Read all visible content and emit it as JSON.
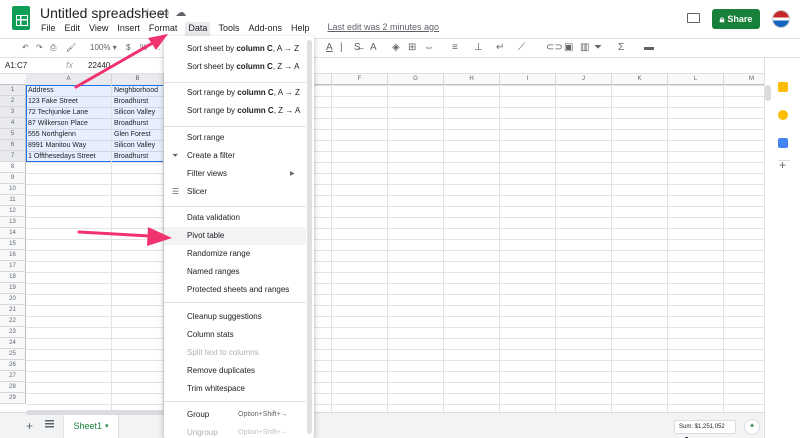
{
  "app": {
    "doc_title": "Untitled spreadsheet",
    "menus": [
      "File",
      "Edit",
      "View",
      "Insert",
      "Format",
      "Data",
      "Tools",
      "Add-ons",
      "Help"
    ],
    "active_menu": "Data",
    "last_edit": "Last edit was 2 minutes ago",
    "share_label": "Share"
  },
  "toolbar": {
    "zoom": "100%",
    "zoom_caret": "▾",
    "partial_percent": "."
  },
  "formula_bar": {
    "name_box": "A1:C7",
    "fx": "fx",
    "value": "22440"
  },
  "columns": [
    "A",
    "B",
    "C",
    "D",
    "E",
    "F",
    "G",
    "H",
    "I",
    "J",
    "K",
    "L",
    "M"
  ],
  "rows": [
    "1",
    "2",
    "3",
    "4",
    "5",
    "6",
    "7",
    "8",
    "9",
    "10",
    "11",
    "12",
    "13",
    "14",
    "15",
    "16",
    "17",
    "18",
    "19",
    "20",
    "21",
    "22",
    "23",
    "24",
    "25",
    "26",
    "27",
    "28",
    "29"
  ],
  "cells": {
    "a": [
      "Address",
      "123 Fake Street",
      "72 Techjunkie Lane",
      "87 Wilkerson Place",
      "555 Northglenn",
      "8991 Manitou Way",
      "1 Offthesedays Street"
    ],
    "b": [
      "Neighborhood",
      "Broadhurst",
      "Silicon Valley",
      "Broadhurst",
      "Glen Forest",
      "Silicon Valley",
      "Broadhurst"
    ]
  },
  "data_menu": {
    "sort_sheet_az_pre": "Sort sheet by ",
    "sort_sheet_az_bold": "column C",
    "sort_sheet_az_post": ", A → Z",
    "sort_sheet_za_pre": "Sort sheet by ",
    "sort_sheet_za_bold": "column C",
    "sort_sheet_za_post": ", Z → A",
    "sort_range_az_pre": "Sort range by ",
    "sort_range_az_bold": "column C",
    "sort_range_az_post": ", A → Z",
    "sort_range_za_pre": "Sort range by ",
    "sort_range_za_bold": "column C",
    "sort_range_za_post": ", Z → A",
    "sort_range": "Sort range",
    "create_filter": "Create a filter",
    "filter_views": "Filter views",
    "slicer": "Slicer",
    "data_validation": "Data validation",
    "pivot_table": "Pivot table",
    "randomize_range": "Randomize range",
    "named_ranges": "Named ranges",
    "protected": "Protected sheets and ranges",
    "cleanup": "Cleanup suggestions",
    "column_stats": "Column stats",
    "split_text": "Split text to columns",
    "remove_duplicates": "Remove duplicates",
    "trim_whitespace": "Trim whitespace",
    "group": "Group",
    "group_shortcut": "Option+Shift+→",
    "ungroup": "Ungroup",
    "ungroup_shortcut": "Option+Shift+←"
  },
  "bottom": {
    "add": "+",
    "sheet_tab": "Sheet1",
    "sheet_caret": "▾",
    "sum": "Sum: $1,251,052",
    "sum_caret": "▾"
  },
  "colors": {
    "accent_green": "#188038",
    "selection_blue": "#1a73e8",
    "arrow_pink": "#f0336e"
  }
}
